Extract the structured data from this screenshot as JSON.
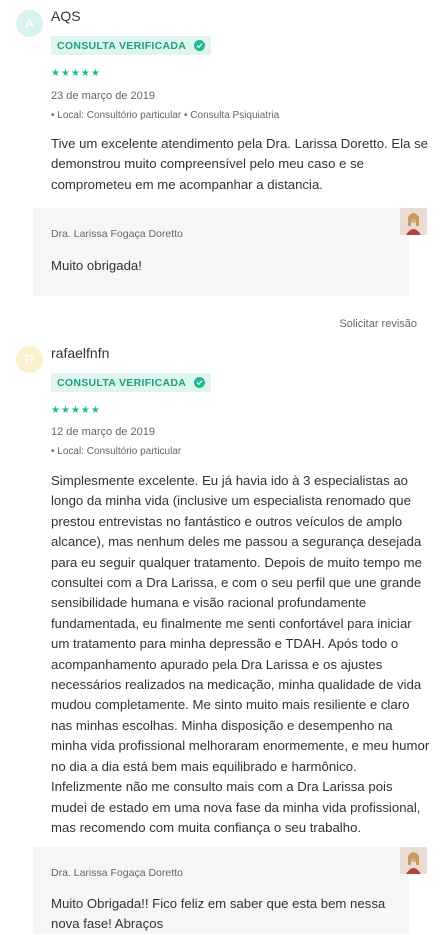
{
  "reviews": [
    {
      "avatar_letter": "A",
      "avatar_color": "#d8f3ee",
      "author": "AQS",
      "badge": "CONSULTA VERIFICADA",
      "rating": 5,
      "date": "23 de março de 2019",
      "meta": "• Local: Consultório particular • Consulta Psiquiatria",
      "text": "Tive um excelente atendimento pela Dra. Larissa Doretto. Ela se demonstrou muito compreensível pelo meu caso e se comprometeu em me acompanhar a distancia.",
      "reply": {
        "doctor": "Dra. Larissa Fogaça Doretto",
        "text": "Muito obrigada!"
      },
      "action": "Solicitar revisão"
    },
    {
      "avatar_letter": "R",
      "avatar_color": "#fdf0cf",
      "author": "rafaelfnfn",
      "badge": "CONSULTA VERIFICADA",
      "rating": 5,
      "date": "12 de março de 2019",
      "meta": "• Local: Consultório particular",
      "text": "Simplesmente excelente. Eu já havia ido à 3 especialistas ao longo da minha vida (inclusive um especialista renomado que prestou entrevistas no fantástico e outros veículos de amplo alcance), mas nenhum deles me passou a segurança desejada para eu seguir qualquer tratamento. Depois de muito tempo me consultei com a Dra Larissa, e com o seu perfil que une grande sensibilidade humana e visão racional profundamente fundamentada, eu finalmente me senti confortável para iniciar um tratamento para minha depressão e TDAH. Após todo o acompanhamento apurado pela Dra Larissa e os ajustes necessários realizados na medicação, minha qualidade de vida mudou completamente. Me sinto muito mais resiliente e claro nas minhas escolhas. Minha disposição e desempenho na minha vida profissional melhoraram enormemente, e meu humor no dia a dia está bem mais equilibrado e harmônico. Infelizmente não me consulto mais com a Dra Larissa pois mudei de estado em uma nova fase da minha vida profissional, mas recomendo com muita confiança o seu trabalho.",
      "reply": {
        "doctor": "Dra. Larissa Fogaça Doretto",
        "text": "Muito Obrigada!! Fico feliz em saber que esta bem nessa nova fase! Abraços"
      }
    }
  ],
  "colors": {
    "accent": "#1fba92",
    "badge_bg": "#e0f4f0",
    "reply_bg": "#f6f6f7"
  }
}
